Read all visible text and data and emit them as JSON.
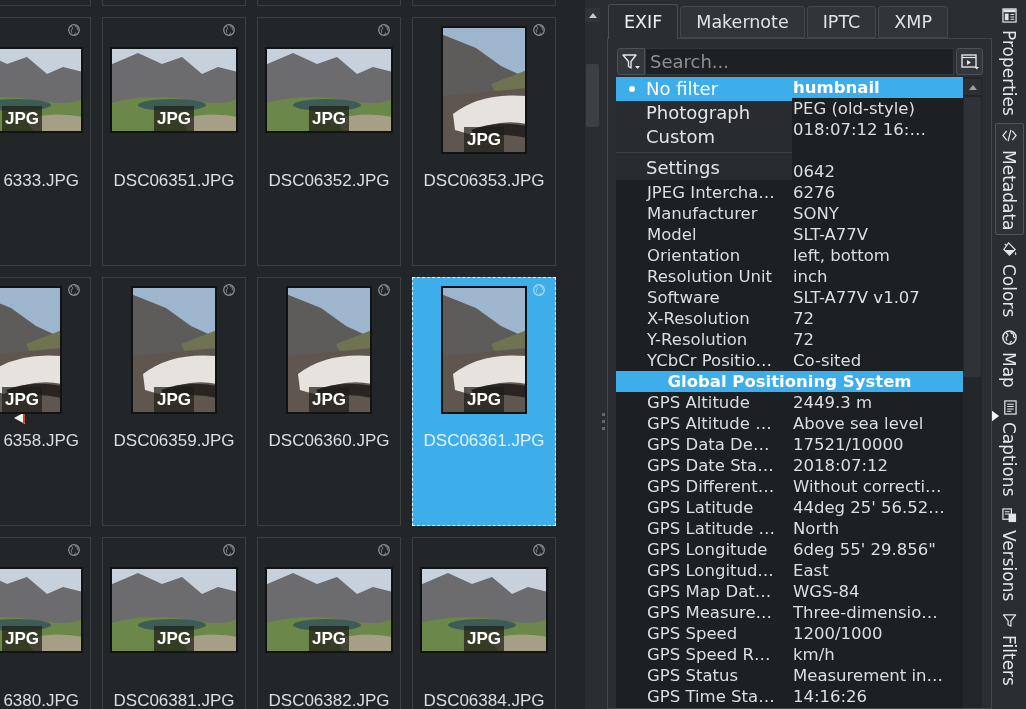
{
  "thumbnail_grid": {
    "rows": [
      [
        {
          "filename": "6333.JPG",
          "kind": "landscape",
          "badge": "JPG",
          "geotagged": true,
          "selected": false,
          "marked": false
        },
        {
          "filename": "DSC06351.JPG",
          "kind": "landscape",
          "badge": "JPG",
          "geotagged": true,
          "selected": false,
          "marked": false
        },
        {
          "filename": "DSC06352.JPG",
          "kind": "landscape",
          "badge": "JPG",
          "geotagged": true,
          "selected": false,
          "marked": false
        },
        {
          "filename": "DSC06353.JPG",
          "kind": "portrait",
          "badge": "JPG",
          "geotagged": true,
          "selected": false,
          "marked": false
        }
      ],
      [
        {
          "filename": "6358.JPG",
          "kind": "portrait",
          "badge": "JPG",
          "geotagged": true,
          "selected": false,
          "marked": true
        },
        {
          "filename": "DSC06359.JPG",
          "kind": "portrait",
          "badge": "JPG",
          "geotagged": true,
          "selected": false,
          "marked": false
        },
        {
          "filename": "DSC06360.JPG",
          "kind": "portrait",
          "badge": "JPG",
          "geotagged": true,
          "selected": false,
          "marked": false
        },
        {
          "filename": "DSC06361.JPG",
          "kind": "portrait",
          "badge": "JPG",
          "geotagged": true,
          "selected": true,
          "marked": false
        }
      ],
      [
        {
          "filename": "6380.JPG",
          "kind": "landscape",
          "badge": "JPG",
          "geotagged": true,
          "selected": false,
          "marked": false
        },
        {
          "filename": "DSC06381.JPG",
          "kind": "landscape",
          "badge": "JPG",
          "geotagged": true,
          "selected": false,
          "marked": false
        },
        {
          "filename": "DSC06382.JPG",
          "kind": "landscape",
          "badge": "JPG",
          "geotagged": true,
          "selected": false,
          "marked": false
        },
        {
          "filename": "DSC06384.JPG",
          "kind": "landscape",
          "badge": "JPG",
          "geotagged": true,
          "selected": false,
          "marked": false
        }
      ]
    ]
  },
  "metadata_panel": {
    "tabs": [
      {
        "label": "EXIF",
        "selected": true
      },
      {
        "label": "Makernote",
        "selected": false
      },
      {
        "label": "IPTC",
        "selected": false
      },
      {
        "label": "XMP",
        "selected": false
      }
    ],
    "search": {
      "placeholder": "Search..."
    },
    "filter_menu": {
      "items": [
        {
          "label": "No filter",
          "kind": "option",
          "selected": true
        },
        {
          "label": "Photograph",
          "kind": "option",
          "selected": false
        },
        {
          "label": "Custom",
          "kind": "option",
          "selected": false
        },
        {
          "label": "Settings",
          "kind": "action"
        }
      ]
    },
    "entries": [
      {
        "kind": "header",
        "label": "humbnail"
      },
      {
        "kind": "tag",
        "value": "PEG (old-style)"
      },
      {
        "kind": "tag",
        "value": "018:07:12 16:…"
      },
      {
        "kind": "tag"
      },
      {
        "kind": "tag",
        "value": "0642"
      },
      {
        "kind": "tag",
        "key": "JPEG Intercha…",
        "value": "6276"
      },
      {
        "kind": "tag",
        "key": "Manufacturer",
        "value": "SONY"
      },
      {
        "kind": "tag",
        "key": "Model",
        "value": "SLT-A77V"
      },
      {
        "kind": "tag",
        "key": "Orientation",
        "value": "left, bottom"
      },
      {
        "kind": "tag",
        "key": "Resolution Unit",
        "value": "inch"
      },
      {
        "kind": "tag",
        "key": "Software",
        "value": "SLT-A77V v1.07"
      },
      {
        "kind": "tag",
        "key": "X-Resolution",
        "value": "72"
      },
      {
        "kind": "tag",
        "key": "Y-Resolution",
        "value": "72"
      },
      {
        "kind": "tag",
        "key": "YCbCr Positio…",
        "value": "Co-sited"
      },
      {
        "kind": "header",
        "label": "Global Positioning System"
      },
      {
        "kind": "tag",
        "key": "GPS Altitude",
        "value": "2449.3 m"
      },
      {
        "kind": "tag",
        "key": "GPS Altitude …",
        "value": "Above sea level"
      },
      {
        "kind": "tag",
        "key": "GPS Data De…",
        "value": "17521/10000"
      },
      {
        "kind": "tag",
        "key": "GPS Date Sta…",
        "value": "2018:07:12"
      },
      {
        "kind": "tag",
        "key": "GPS Different…",
        "value": "Without correcti…"
      },
      {
        "kind": "tag",
        "key": "GPS Latitude",
        "value": "44deg 25' 56.52…"
      },
      {
        "kind": "tag",
        "key": "GPS Latitude …",
        "value": "North"
      },
      {
        "kind": "tag",
        "key": "GPS Longitude",
        "value": "6deg 55' 29.856\""
      },
      {
        "kind": "tag",
        "key": "GPS Longitud…",
        "value": "East"
      },
      {
        "kind": "tag",
        "key": "GPS Map Dat…",
        "value": "WGS-84"
      },
      {
        "kind": "tag",
        "key": "GPS Measure…",
        "value": "Three-dimensio…"
      },
      {
        "kind": "tag",
        "key": "GPS Speed",
        "value": "1200/1000"
      },
      {
        "kind": "tag",
        "key": "GPS Speed R…",
        "value": "km/h"
      },
      {
        "kind": "tag",
        "key": "GPS Status",
        "value": "Measurement in…"
      },
      {
        "kind": "tag",
        "key": "GPS Time Sta…",
        "value": "14:16:26"
      }
    ]
  },
  "side_tabs": [
    {
      "label": "Properties",
      "selected": false
    },
    {
      "label": "Metadata",
      "selected": true
    },
    {
      "label": "Colors",
      "selected": false
    },
    {
      "label": "Map",
      "selected": false
    },
    {
      "label": "Captions",
      "selected": false
    },
    {
      "label": "Versions",
      "selected": false
    },
    {
      "label": "Filters",
      "selected": false
    }
  ]
}
